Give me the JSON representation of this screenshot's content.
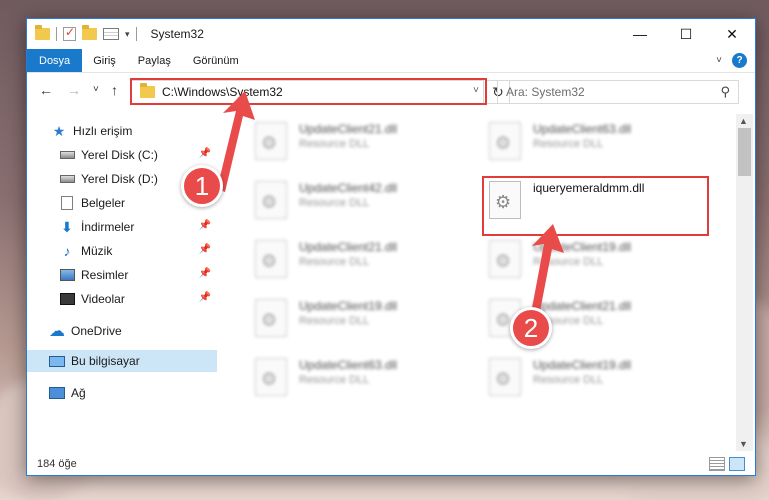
{
  "window": {
    "title": "System32",
    "controls": {
      "minimize": "—",
      "maximize": "☐",
      "close": "✕"
    }
  },
  "ribbon": {
    "tabs": [
      {
        "label": "Dosya",
        "active": true
      },
      {
        "label": "Giriş"
      },
      {
        "label": "Paylaş"
      },
      {
        "label": "Görünüm"
      }
    ],
    "help": "?"
  },
  "nav": {
    "back": "←",
    "forward": "→",
    "recent": "˅",
    "up": "↑",
    "address_path": "C:\\Windows\\System32",
    "refresh": "↻",
    "search_placeholder": "Ara: System32"
  },
  "sidebar": {
    "items": [
      {
        "label": "Hızlı erişim",
        "icon": "star-icon"
      },
      {
        "label": "Yerel Disk (C:)",
        "icon": "disk-icon",
        "pinned": true
      },
      {
        "label": "Yerel Disk (D:)",
        "icon": "disk-icon"
      },
      {
        "label": "Belgeler",
        "icon": "documents-icon"
      },
      {
        "label": "İndirmeler",
        "icon": "downloads-icon",
        "pinned": true
      },
      {
        "label": "Müzik",
        "icon": "music-icon",
        "pinned": true
      },
      {
        "label": "Resimler",
        "icon": "pictures-icon",
        "pinned": true
      },
      {
        "label": "Videolar",
        "icon": "videos-icon",
        "pinned": true
      },
      {
        "label": "OneDrive",
        "icon": "onedrive-icon"
      },
      {
        "label": "Bu bilgisayar",
        "icon": "pc-icon",
        "selected": true
      },
      {
        "label": "Ağ",
        "icon": "network-icon"
      }
    ]
  },
  "files": [
    {
      "name": "UpdateClient21.dll",
      "type": "Resource DLL"
    },
    {
      "name": "UpdateClient63.dll",
      "type": "Resource DLL"
    },
    {
      "name": "UpdateClient42.dll",
      "type": "Resource DLL"
    },
    {
      "name": "iqueryemeraldmm.dll",
      "type": "",
      "highlighted": true
    },
    {
      "name": "UpdateClient21.dll",
      "type": "Resource DLL"
    },
    {
      "name": "UpdateClient19.dll",
      "type": "Resource DLL"
    },
    {
      "name": "UpdateClient19.dll",
      "type": "Resource DLL"
    },
    {
      "name": "UpdateClient21.dll",
      "type": "Resource DLL"
    },
    {
      "name": "UpdateClient63.dll",
      "type": "Resource DLL"
    },
    {
      "name": "UpdateClient19.dll",
      "type": "Resource DLL"
    }
  ],
  "status": {
    "count": "184 öğe"
  },
  "annotations": {
    "step1": "1",
    "step2": "2",
    "accent": "#e94b4b"
  }
}
